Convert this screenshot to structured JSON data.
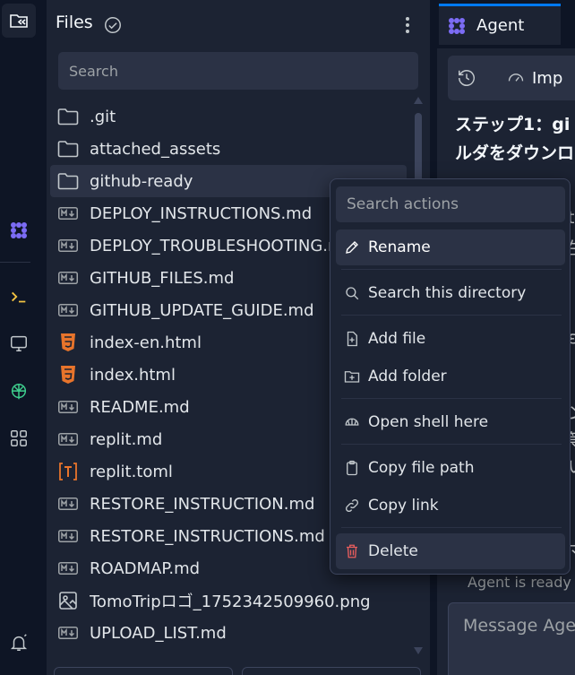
{
  "files_panel": {
    "title": "Files",
    "search_placeholder": "Search",
    "items": [
      {
        "name": ".git",
        "icon": "folder-icon"
      },
      {
        "name": "attached_assets",
        "icon": "folder-icon"
      },
      {
        "name": "github-ready",
        "icon": "folder-icon",
        "selected": true
      },
      {
        "name": "DEPLOY_INSTRUCTIONS.md",
        "icon": "markdown-icon"
      },
      {
        "name": "DEPLOY_TROUBLESHOOTING.md",
        "icon": "markdown-icon"
      },
      {
        "name": "GITHUB_FILES.md",
        "icon": "markdown-icon"
      },
      {
        "name": "GITHUB_UPDATE_GUIDE.md",
        "icon": "markdown-icon"
      },
      {
        "name": "index-en.html",
        "icon": "html5-icon"
      },
      {
        "name": "index.html",
        "icon": "html5-icon"
      },
      {
        "name": "README.md",
        "icon": "markdown-icon"
      },
      {
        "name": "replit.md",
        "icon": "markdown-icon"
      },
      {
        "name": "replit.toml",
        "icon": "toml-icon"
      },
      {
        "name": "RESTORE_INSTRUCTION.md",
        "icon": "markdown-icon"
      },
      {
        "name": "RESTORE_INSTRUCTIONS.md",
        "icon": "markdown-icon"
      },
      {
        "name": "ROADMAP.md",
        "icon": "markdown-icon"
      },
      {
        "name": "TomoTripロゴ_1752342509960.png",
        "icon": "image-icon"
      },
      {
        "name": "UPLOAD_LIST.md",
        "icon": "markdown-icon"
      }
    ]
  },
  "context_menu": {
    "search_placeholder": "Search actions",
    "items": [
      {
        "label": "Rename",
        "icon": "pencil-icon"
      },
      {
        "label": "Search this directory",
        "icon": "search-icon"
      },
      {
        "label": "Add file",
        "icon": "add-file-icon"
      },
      {
        "label": "Add folder",
        "icon": "add-folder-icon"
      },
      {
        "label": "Open shell here",
        "icon": "shell-icon"
      },
      {
        "label": "Copy file path",
        "icon": "clipboard-icon"
      },
      {
        "label": "Copy link",
        "icon": "link-icon"
      },
      {
        "label": "Delete",
        "icon": "trash-icon"
      }
    ]
  },
  "agent_panel": {
    "tab_label": "Agent",
    "toolbar_label": "Imp",
    "heading_line1": "ステップ1：gi",
    "heading_line2": "ルダをダウンロ",
    "peek_chars": [
      "t",
      "生",
      "",
      "ε",
      "",
      "ン",
      "等",
      "い",
      "",
      "マ"
    ],
    "status": "Agent is ready",
    "input_placeholder": "Message Agent"
  },
  "colors": {
    "background": "#0e1525",
    "panel": "#1c2333",
    "field": "#2b3245",
    "accent": "#0079f2",
    "agent_purple": "#7c6cf5",
    "html_orange": "#e8742b",
    "danger": "#e85d5d"
  }
}
